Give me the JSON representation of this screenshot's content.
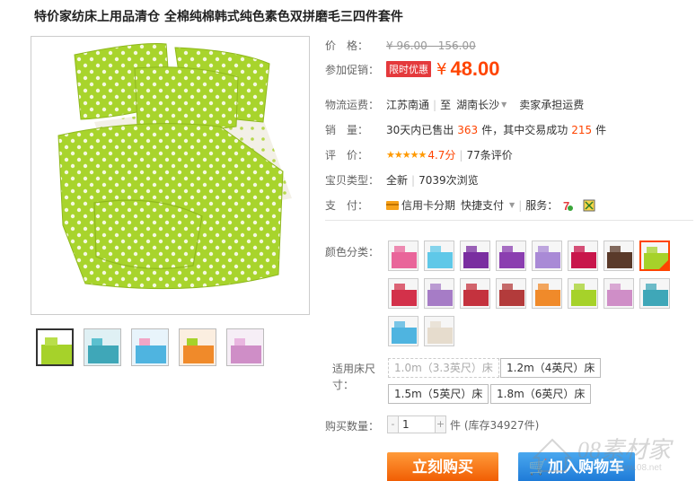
{
  "product": {
    "title": "特价家纺床上用品清仓 全棉纯棉韩式纯色素色双拼磨毛三四件套件"
  },
  "price": {
    "label": "价　格：",
    "original": "¥ 96.00 - 156.00"
  },
  "promo": {
    "label": "参加促销：",
    "tag": "限时优惠",
    "currency": "¥",
    "value": "48.00"
  },
  "shipping": {
    "label": "物流运费：",
    "from": "江苏南通",
    "to_word": "至",
    "to": "湖南长沙",
    "fee": "卖家承担运费"
  },
  "sales": {
    "label": "销　量：",
    "prefix": "30天内已售出",
    "count": "363",
    "unit": "件，其中交易成功",
    "success": "215",
    "unit2": "件"
  },
  "rating": {
    "label": "评　价：",
    "stars": "★★★★★",
    "score": "4.7分",
    "reviews": "77条评价"
  },
  "type": {
    "label": "宝贝类型：",
    "value": "全新",
    "views": "7039次浏览"
  },
  "payment": {
    "label": "支　付：",
    "credit": "信用卡分期",
    "fast": "快捷支付",
    "service_label": "服务："
  },
  "color": {
    "label": "颜色分类："
  },
  "size": {
    "label": "适用床尺寸：",
    "options": [
      "1.0m（3.3英尺）床",
      "1.2m（4英尺）床",
      "1.5m（5英尺）床",
      "1.8m（6英尺）床"
    ]
  },
  "quantity": {
    "label": "购买数量：",
    "minus": "-",
    "plus": "+",
    "value": "1",
    "stock": "件 (库存34927件)"
  },
  "actions": {
    "buy": "立刻购买",
    "cart": "加入购物车"
  },
  "watermark": {
    "text": "08素材家",
    "sub": "www.08.net"
  },
  "colors": {
    "accent": "#ff4400",
    "lime": "#a6d22a",
    "swatches": [
      "#e9659a",
      "#5fc8e8",
      "#7a2ea0",
      "#8b3fb0",
      "#a98ad6",
      "#c8164b",
      "#5a3a2a",
      "#a6d22a",
      "#d3314a",
      "#a67cc6",
      "#c4323e",
      "#b33b3b",
      "#f08a2a",
      "#a6d22a",
      "#cf8ec7",
      "#3fa7b8",
      "#4fb4e0",
      "#e6dccd"
    ]
  }
}
